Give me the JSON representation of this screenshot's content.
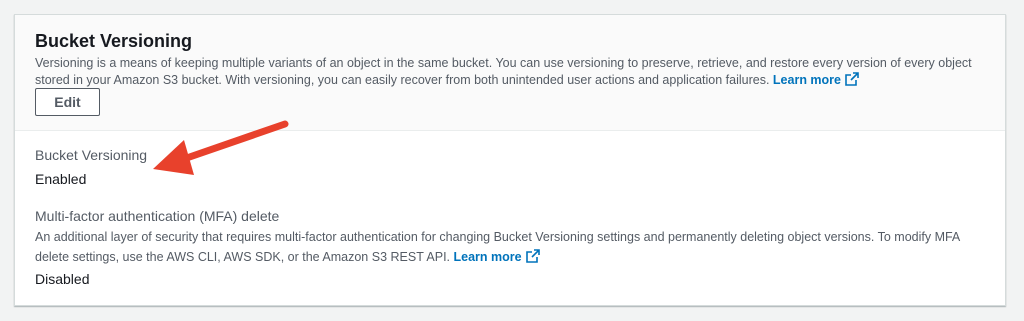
{
  "section": {
    "title": "Bucket Versioning",
    "description": "Versioning is a means of keeping multiple variants of an object in the same bucket. You can use versioning to preserve, retrieve, and restore every version of every object stored in your Amazon S3 bucket. With versioning, you can easily recover from both unintended user actions and application failures.",
    "learn_more": "Learn more",
    "edit_label": "Edit"
  },
  "versioning": {
    "label": "Bucket Versioning",
    "value": "Enabled"
  },
  "mfa": {
    "label": "Multi-factor authentication (MFA) delete",
    "description": "An additional layer of security that requires multi-factor authentication for changing Bucket Versioning settings and permanently deleting object versions. To modify MFA delete settings, use the AWS CLI, AWS SDK, or the Amazon S3 REST API.",
    "learn_more": "Learn more",
    "value": "Disabled"
  },
  "colors": {
    "link": "#0073bb",
    "arrow": "#e8412c",
    "text_secondary": "#545b64"
  },
  "icons": {
    "external_link": "external-link-icon",
    "annotation_arrow": "annotation-arrow"
  }
}
